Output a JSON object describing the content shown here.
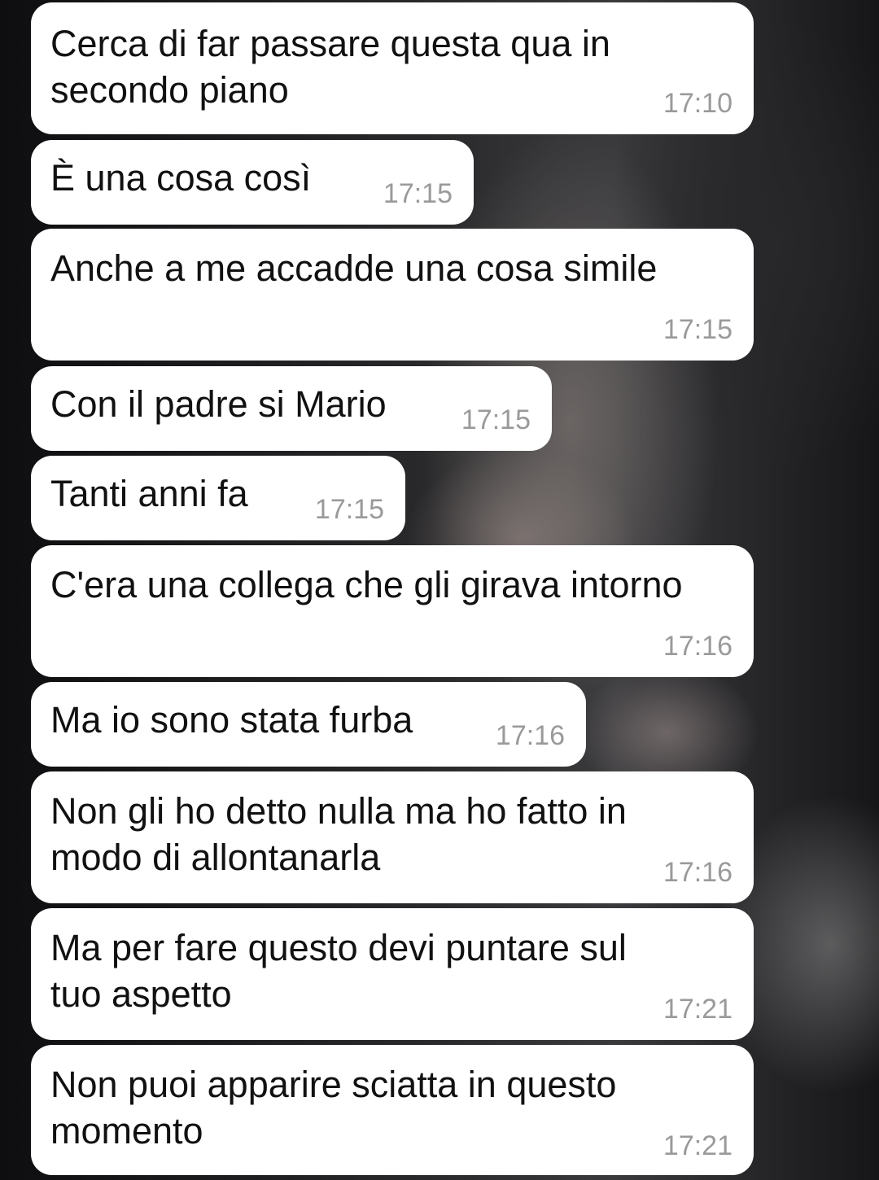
{
  "messages": [
    {
      "lines": [
        "Cerca di far passare questa qua in",
        "secondo piano"
      ],
      "time": "17:10"
    },
    {
      "lines": [
        "È una cosa così"
      ],
      "time": "17:15"
    },
    {
      "lines": [
        "Anche a me accadde una cosa simile"
      ],
      "time": "17:15"
    },
    {
      "lines": [
        "Con il padre si Mario"
      ],
      "time": "17:15"
    },
    {
      "lines": [
        "Tanti anni fa"
      ],
      "time": "17:15"
    },
    {
      "lines": [
        "C'era una collega che gli girava intorno"
      ],
      "time": "17:16"
    },
    {
      "lines": [
        "Ma io sono stata furba"
      ],
      "time": "17:16"
    },
    {
      "lines": [
        "Non gli ho detto nulla ma ho fatto in",
        "modo di allontanarla"
      ],
      "time": "17:16"
    },
    {
      "lines": [
        "Ma per fare questo devi puntare sul",
        "tuo aspetto"
      ],
      "time": "17:21"
    },
    {
      "lines": [
        "Non puoi apparire sciatta in questo",
        "momento"
      ],
      "time": "17:21"
    }
  ]
}
